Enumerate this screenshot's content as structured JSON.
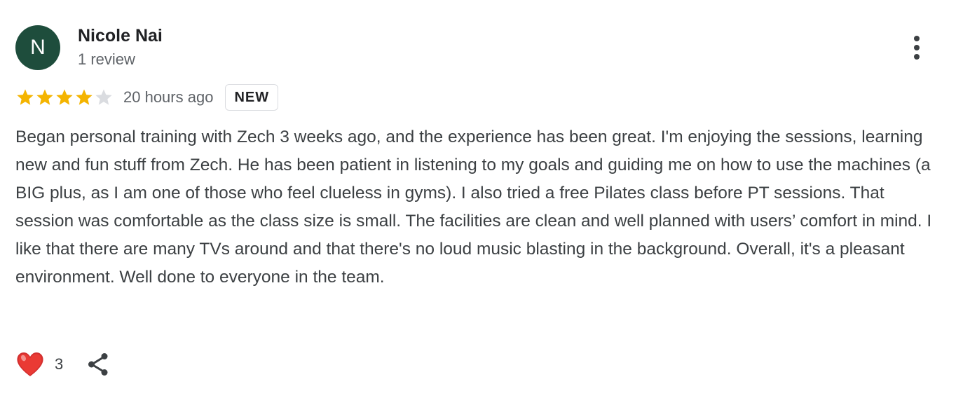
{
  "review": {
    "author": {
      "initial": "N",
      "avatar_color": "#1e4d3c",
      "name": "Nicole Nai",
      "review_count": "1 review"
    },
    "rating": {
      "value": 4,
      "max": 5,
      "filled_color": "#f4b400",
      "empty_color": "#dadce0"
    },
    "time_ago": "20 hours ago",
    "badge": "NEW",
    "text": "Began personal training with Zech 3 weeks ago, and the experience has been great. I'm enjoying the sessions, learning new and fun stuff from Zech. He has been patient in listening to my goals and guiding me on how to use the machines (a BIG plus, as I am one of those who feel clueless in gyms). I also tried a free Pilates class before PT sessions. That session was comfortable as the class size is small. The facilities are clean and well planned with users’ comfort in mind. I like that there are many TVs around and that there's no loud music blasting in the background. Overall, it's a pleasant environment. Well done to everyone in the team.",
    "actions": {
      "like_icon": "heart-icon",
      "like_count": "3",
      "share_icon": "share-icon",
      "more_icon": "more-vertical-icon"
    }
  }
}
